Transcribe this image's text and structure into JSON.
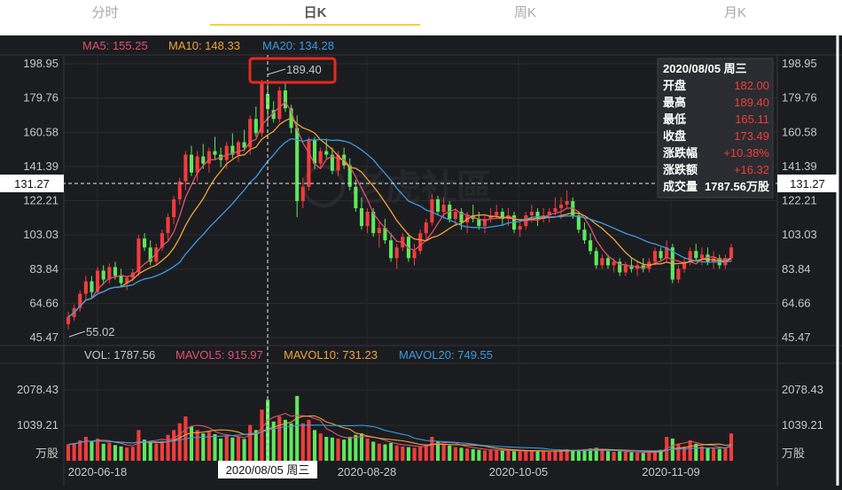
{
  "tabs": [
    {
      "label": "分时",
      "active": false
    },
    {
      "label": "日K",
      "active": true
    },
    {
      "label": "周K",
      "active": false
    },
    {
      "label": "月K",
      "active": false
    }
  ],
  "ma_legend": [
    {
      "label": "MA5: 155.25",
      "color": "#e0516e"
    },
    {
      "label": "MA10: 148.33",
      "color": "#f0a436"
    },
    {
      "label": "MA20: 134.28",
      "color": "#3a9be0"
    }
  ],
  "vol_legend": [
    {
      "label": "VOL: 1787.56",
      "color": "#c8c8c8"
    },
    {
      "label": "MAVOL5: 915.97",
      "color": "#e0516e"
    },
    {
      "label": "MAVOL10: 731.23",
      "color": "#f0a436"
    },
    {
      "label": "MAVOL20: 749.55",
      "color": "#3a9be0"
    }
  ],
  "price_ticks": [
    "198.95",
    "179.76",
    "160.58",
    "141.39",
    "122.21",
    "103.03",
    "83.84",
    "64.66",
    "45.47"
  ],
  "volume_ticks": [
    "2078.43",
    "1039.21",
    "万股"
  ],
  "x_ticks": [
    "2020-06-18",
    "2020-08-28",
    "2020-10-05",
    "2020-11-09"
  ],
  "crosshair": {
    "price_label": "131.27",
    "date_label": "2020/08/05 周三"
  },
  "annotations": {
    "high": "189.40",
    "low": "55.02"
  },
  "watermark": "老虎社區",
  "tooltip": {
    "title": "2020/08/05 周三",
    "rows": [
      {
        "label": "开盘",
        "value": "182.00"
      },
      {
        "label": "最高",
        "value": "189.40"
      },
      {
        "label": "最低",
        "value": "165.11"
      },
      {
        "label": "收盘",
        "value": "173.49"
      },
      {
        "label": "涨跌幅",
        "value": "+10.38%"
      },
      {
        "label": "涨跌额",
        "value": "+16.32"
      },
      {
        "label": "成交量",
        "value": "1787.56万股"
      }
    ]
  },
  "colors": {
    "up": "#f23c3c",
    "down": "#5de85d",
    "background": "#1b1c20",
    "highlight": "#e8291e"
  },
  "chart_data": {
    "type": "candlestick",
    "price_range": [
      45.47,
      198.95
    ],
    "volume_range": [
      0,
      2078.43
    ],
    "candles": [
      [
        53,
        60,
        50,
        57,
        480
      ],
      [
        57,
        64,
        55,
        62,
        520
      ],
      [
        62,
        72,
        60,
        70,
        600
      ],
      [
        70,
        80,
        66,
        77,
        700
      ],
      [
        77,
        80,
        68,
        71,
        560
      ],
      [
        71,
        85,
        70,
        83,
        650
      ],
      [
        83,
        86,
        75,
        78,
        500
      ],
      [
        78,
        87,
        76,
        85,
        530
      ],
      [
        85,
        88,
        78,
        80,
        460
      ],
      [
        80,
        84,
        74,
        76,
        420
      ],
      [
        76,
        80,
        72,
        79,
        390
      ],
      [
        79,
        84,
        77,
        82,
        410
      ],
      [
        82,
        103,
        80,
        101,
        900
      ],
      [
        101,
        104,
        94,
        96,
        620
      ],
      [
        96,
        100,
        86,
        88,
        560
      ],
      [
        88,
        98,
        86,
        96,
        500
      ],
      [
        96,
        106,
        94,
        104,
        580
      ],
      [
        104,
        115,
        100,
        113,
        760
      ],
      [
        113,
        125,
        109,
        123,
        900
      ],
      [
        123,
        135,
        120,
        133,
        1100
      ],
      [
        133,
        150,
        128,
        148,
        1300
      ],
      [
        148,
        153,
        136,
        138,
        1000
      ],
      [
        138,
        150,
        133,
        147,
        900
      ],
      [
        147,
        154,
        140,
        143,
        800
      ],
      [
        143,
        152,
        138,
        150,
        850
      ],
      [
        150,
        158,
        145,
        148,
        780
      ],
      [
        148,
        152,
        141,
        145,
        650
      ],
      [
        145,
        155,
        140,
        153,
        720
      ],
      [
        153,
        160,
        146,
        148,
        680
      ],
      [
        148,
        156,
        144,
        155,
        700
      ],
      [
        155,
        162,
        150,
        152,
        640
      ],
      [
        152,
        170,
        148,
        168,
        1050
      ],
      [
        168,
        175,
        158,
        160,
        900
      ],
      [
        160,
        190,
        158,
        188,
        1500
      ],
      [
        182,
        189.4,
        165.11,
        173.49,
        1787.56
      ],
      [
        173,
        178,
        166,
        168,
        1150
      ],
      [
        168,
        186,
        166,
        184,
        1300
      ],
      [
        184,
        188,
        172,
        174,
        1200
      ],
      [
        174,
        176,
        160,
        163,
        1100
      ],
      [
        163,
        170,
        113,
        122,
        1900
      ],
      [
        122,
        135,
        118,
        130,
        1100
      ],
      [
        130,
        158,
        128,
        156,
        1200
      ],
      [
        156,
        158,
        140,
        143,
        900
      ],
      [
        143,
        152,
        140,
        150,
        800
      ],
      [
        150,
        157,
        146,
        148,
        700
      ],
      [
        148,
        152,
        137,
        139,
        680
      ],
      [
        139,
        150,
        136,
        148,
        650
      ],
      [
        148,
        152,
        140,
        142,
        620
      ],
      [
        142,
        146,
        128,
        130,
        700
      ],
      [
        130,
        134,
        116,
        118,
        760
      ],
      [
        118,
        124,
        106,
        108,
        800
      ],
      [
        108,
        118,
        104,
        116,
        650
      ],
      [
        116,
        118,
        102,
        104,
        560
      ],
      [
        104,
        110,
        96,
        107,
        500
      ],
      [
        107,
        112,
        98,
        100,
        480
      ],
      [
        100,
        104,
        88,
        90,
        520
      ],
      [
        90,
        98,
        84,
        96,
        450
      ],
      [
        96,
        104,
        94,
        102,
        420
      ],
      [
        102,
        104,
        88,
        90,
        400
      ],
      [
        90,
        98,
        86,
        94,
        380
      ],
      [
        94,
        106,
        92,
        104,
        420
      ],
      [
        104,
        112,
        100,
        110,
        480
      ],
      [
        110,
        126,
        108,
        123,
        700
      ],
      [
        123,
        125,
        114,
        116,
        560
      ],
      [
        116,
        124,
        112,
        120,
        500
      ],
      [
        120,
        122,
        110,
        112,
        450
      ],
      [
        112,
        118,
        108,
        116,
        400
      ],
      [
        116,
        118,
        106,
        110,
        380
      ],
      [
        110,
        116,
        104,
        114,
        360
      ],
      [
        114,
        120,
        110,
        112,
        340
      ],
      [
        112,
        116,
        106,
        108,
        320
      ],
      [
        108,
        114,
        104,
        112,
        300
      ],
      [
        112,
        118,
        110,
        114,
        310
      ],
      [
        114,
        120,
        112,
        116,
        320
      ],
      [
        116,
        118,
        108,
        112,
        300
      ],
      [
        112,
        118,
        108,
        114,
        290
      ],
      [
        114,
        116,
        104,
        106,
        280
      ],
      [
        106,
        110,
        102,
        108,
        270
      ],
      [
        108,
        116,
        106,
        114,
        290
      ],
      [
        114,
        120,
        110,
        116,
        300
      ],
      [
        116,
        118,
        108,
        112,
        280
      ],
      [
        112,
        118,
        110,
        114,
        270
      ],
      [
        114,
        118,
        110,
        116,
        260
      ],
      [
        116,
        124,
        114,
        118,
        300
      ],
      [
        118,
        124,
        112,
        120,
        310
      ],
      [
        120,
        128,
        118,
        122,
        340
      ],
      [
        122,
        124,
        112,
        114,
        300
      ],
      [
        114,
        116,
        104,
        106,
        320
      ],
      [
        106,
        110,
        98,
        100,
        340
      ],
      [
        100,
        104,
        92,
        94,
        360
      ],
      [
        94,
        96,
        84,
        86,
        380
      ],
      [
        86,
        92,
        84,
        90,
        300
      ],
      [
        90,
        92,
        84,
        86,
        280
      ],
      [
        86,
        90,
        82,
        88,
        260
      ],
      [
        88,
        90,
        80,
        82,
        280
      ],
      [
        82,
        88,
        80,
        86,
        260
      ],
      [
        86,
        90,
        82,
        84,
        250
      ],
      [
        84,
        88,
        80,
        86,
        240
      ],
      [
        86,
        90,
        82,
        84,
        230
      ],
      [
        84,
        90,
        82,
        88,
        240
      ],
      [
        88,
        96,
        86,
        94,
        300
      ],
      [
        94,
        96,
        88,
        90,
        320
      ],
      [
        90,
        100,
        88,
        96,
        700
      ],
      [
        96,
        98,
        76,
        78,
        650
      ],
      [
        78,
        86,
        76,
        84,
        500
      ],
      [
        84,
        90,
        82,
        88,
        420
      ],
      [
        88,
        96,
        86,
        94,
        600
      ],
      [
        94,
        98,
        88,
        90,
        500
      ],
      [
        90,
        96,
        86,
        92,
        420
      ],
      [
        92,
        96,
        86,
        88,
        380
      ],
      [
        88,
        94,
        84,
        90,
        360
      ],
      [
        90,
        92,
        84,
        86,
        350
      ],
      [
        86,
        92,
        84,
        90,
        370
      ],
      [
        90,
        98,
        88,
        96,
        800
      ]
    ]
  }
}
